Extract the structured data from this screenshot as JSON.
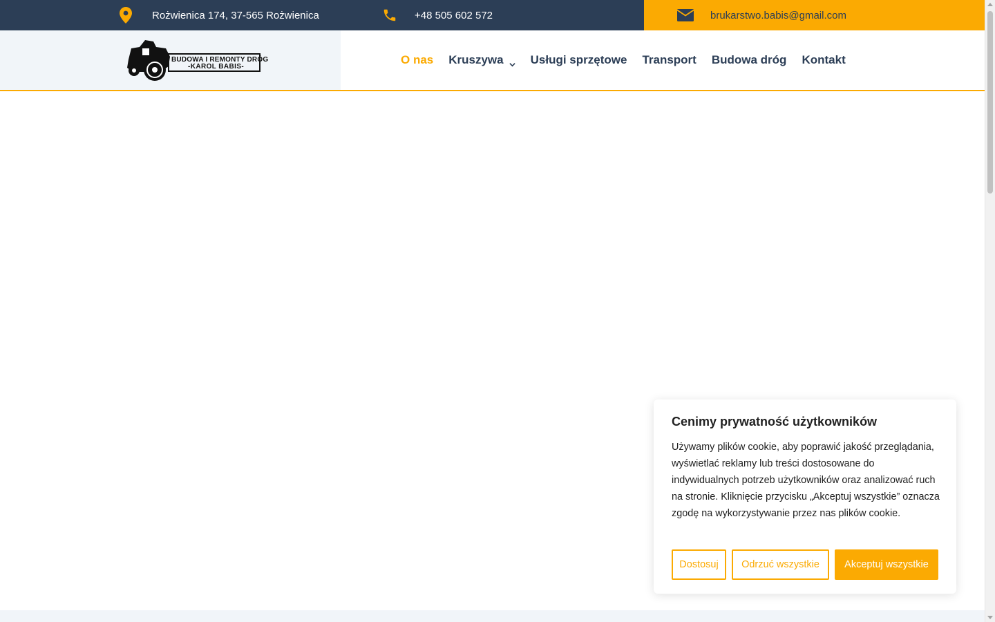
{
  "topbar": {
    "address": "Rożwienica 174, 37-565 Rożwienica",
    "phone": "+48 505 602 572",
    "email": "brukarstwo.babis@gmail.com",
    "icons": {
      "address": "map-pin-icon",
      "phone": "phone-icon",
      "email": "envelope-icon"
    }
  },
  "logo": {
    "line1": "BUDOWA I REMONTY DRÓG",
    "line2": "-KAROL BABIS-"
  },
  "nav": {
    "items": [
      {
        "label": "O nas",
        "active": true
      },
      {
        "label": "Kruszywa",
        "has_dropdown": true
      },
      {
        "label": "Usługi sprzętowe"
      },
      {
        "label": "Transport"
      },
      {
        "label": "Budowa dróg"
      },
      {
        "label": "Kontakt"
      }
    ]
  },
  "cookie": {
    "title": "Cenimy prywatność użytkowników",
    "body": "Używamy plików cookie, aby poprawić jakość przeglądania, wyświetlać reklamy lub treści dostosowane do indywidualnych potrzeb użytkowników oraz analizować ruch na stronie. Kliknięcie przycisku „Akceptuj wszystkie” oznacza zgodę na wykorzystywanie przez nas plików cookie.",
    "customize_label": "Dostosuj",
    "reject_label": "Odrzuć wszystkie",
    "accept_label": "Akceptuj wszystkie"
  },
  "colors": {
    "accent": "#fbaa02",
    "navy": "#2c3e56",
    "panel": "#f1f5f9"
  }
}
